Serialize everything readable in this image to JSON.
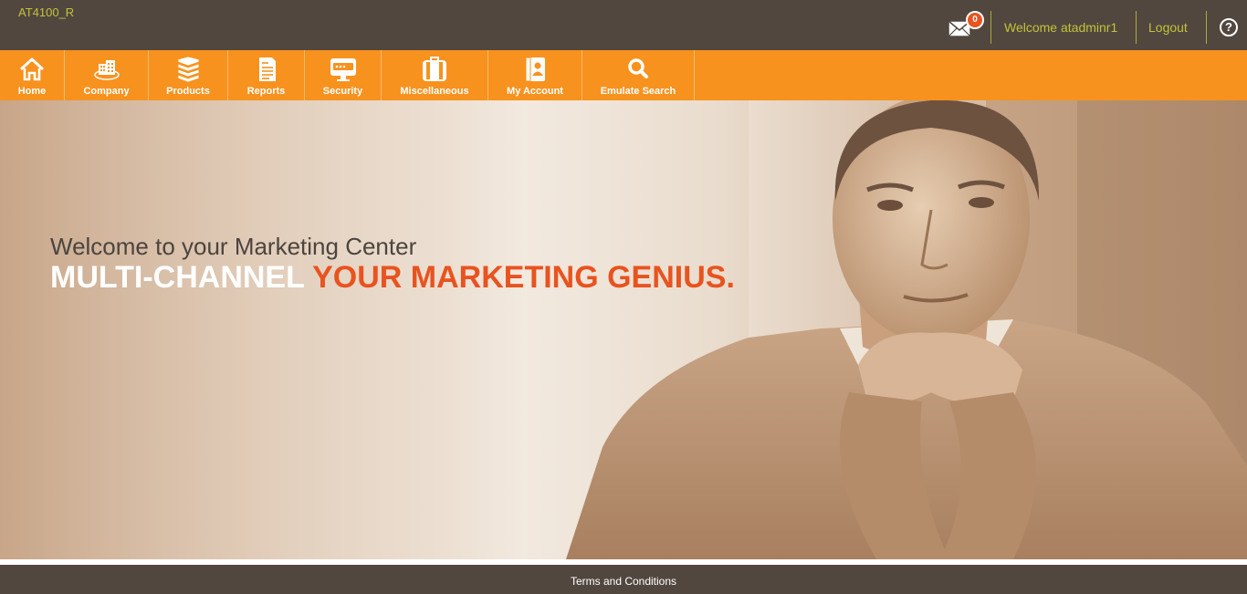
{
  "header": {
    "site_code": "AT4100_R",
    "mail_count": "0",
    "welcome": "Welcome atadminr1",
    "logout": "Logout",
    "help": "?"
  },
  "nav": {
    "items": [
      {
        "label": "Home",
        "icon": "home-icon"
      },
      {
        "label": "Company",
        "icon": "building-icon"
      },
      {
        "label": "Products",
        "icon": "products-stack-icon"
      },
      {
        "label": "Reports",
        "icon": "report-document-icon"
      },
      {
        "label": "Security",
        "icon": "monitor-password-icon"
      },
      {
        "label": "Miscellaneous",
        "icon": "luggage-icon"
      },
      {
        "label": "My Account",
        "icon": "account-book-icon"
      },
      {
        "label": "Emulate Search",
        "icon": "search-icon"
      }
    ]
  },
  "hero": {
    "subtitle": "Welcome to your Marketing Center",
    "title_part1": "MULTI-CHANNEL",
    "title_part2": "YOUR MARKETING GENIUS."
  },
  "footer": {
    "terms": "Terms and Conditions"
  },
  "colors": {
    "header_bg": "#52473f",
    "nav_bg": "#f7921e",
    "accent_text": "#c2c23a",
    "headline_orange": "#e8531f"
  }
}
